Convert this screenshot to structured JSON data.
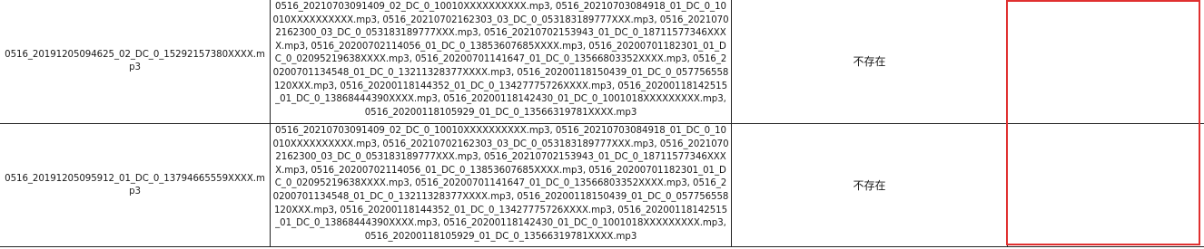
{
  "rows": [
    {
      "file": "0516_20191205094625_02_DC_0_15292157380XXXX.mp3",
      "matches": "0516_20210703091409_02_DC_0_10010XXXXXXXXXX.mp3, 0516_20210703084918_01_DC_0_10010XXXXXXXXXX.mp3, 0516_20210702162303_03_DC_0_053183189777XXX.mp3, 0516_20210702162300_03_DC_0_053183189777XXX.mp3, 0516_20210702153943_01_DC_0_18711577346XXXX.mp3, 0516_20200702114056_01_DC_0_13853607685XXXX.mp3, 0516_20200701182301_01_DC_0_02095219638XXXX.mp3, 0516_20200701141647_01_DC_0_13566803352XXXX.mp3, 0516_20200701134548_01_DC_0_13211328377XXXX.mp3, 0516_20200118150439_01_DC_0_057756558120XXX.mp3, 0516_20200118144352_01_DC_0_13427775726XXXX.mp3, 0516_20200118142515_01_DC_0_13868444390XXXX.mp3, 0516_20200118142430_01_DC_0_1001018XXXXXXXXX.mp3, 0516_20200118105929_01_DC_0_13566319781XXXX.mp3",
      "status": "不存在",
      "extra": ""
    },
    {
      "file": "0516_20191205095912_01_DC_0_13794665559XXXX.mp3",
      "matches": "0516_20210703091409_02_DC_0_10010XXXXXXXXXX.mp3, 0516_20210703084918_01_DC_0_10010XXXXXXXXXX.mp3, 0516_20210702162303_03_DC_0_053183189777XXX.mp3, 0516_20210702162300_03_DC_0_053183189777XXX.mp3, 0516_20210702153943_01_DC_0_18711577346XXXX.mp3, 0516_20200702114056_01_DC_0_13853607685XXXX.mp3, 0516_20200701182301_01_DC_0_02095219638XXXX.mp3, 0516_20200701141647_01_DC_0_13566803352XXXX.mp3, 0516_20200701134548_01_DC_0_13211328377XXXX.mp3, 0516_20200118150439_01_DC_0_057756558120XXX.mp3, 0516_20200118144352_01_DC_0_13427775726XXXX.mp3, 0516_20200118142515_01_DC_0_13868444390XXXX.mp3, 0516_20200118142430_01_DC_0_1001018XXXXXXXXX.mp3, 0516_20200118105929_01_DC_0_13566319781XXXX.mp3",
      "status": "不存在",
      "extra": ""
    }
  ],
  "colors": {
    "grid": "#222222",
    "selection": "#e03030",
    "background": "#ffffff"
  }
}
